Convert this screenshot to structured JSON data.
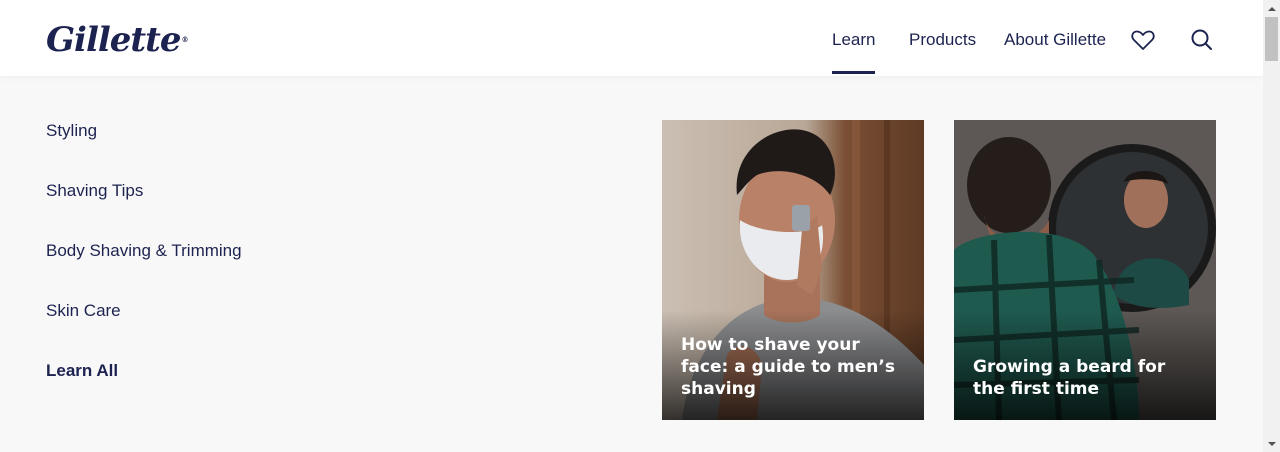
{
  "brand": {
    "logo_text": "Gillette",
    "registered_mark": "®",
    "color": "#1d2350"
  },
  "nav": {
    "items": [
      {
        "label": "Learn",
        "active": true
      },
      {
        "label": "Products",
        "active": false
      },
      {
        "label": "About Gillette",
        "active": false
      }
    ],
    "icons": [
      "heart-icon",
      "search-icon"
    ]
  },
  "menu": {
    "items": [
      {
        "label": "Styling"
      },
      {
        "label": "Shaving Tips"
      },
      {
        "label": "Body Shaving & Trimming"
      },
      {
        "label": "Skin Care"
      },
      {
        "label": "Learn All"
      }
    ]
  },
  "cards": [
    {
      "caption": "How to shave your face: a guide to men’s shaving"
    },
    {
      "caption": "Growing a beard for the first time"
    }
  ],
  "colors": {
    "background": "#f8f8f8",
    "header": "#ffffff",
    "text": "#1d2350"
  }
}
